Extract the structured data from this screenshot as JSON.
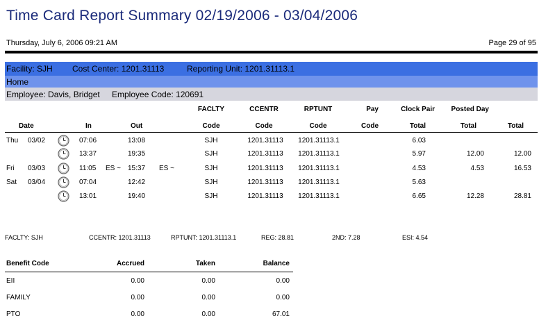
{
  "report": {
    "title": "Time Card Report Summary 02/19/2006 - 03/04/2006",
    "printed": "Thursday, July 6, 2006 09:21 AM",
    "page": "Page 29 of 95"
  },
  "context": {
    "facility": "Facility: SJH",
    "cost_center": "Cost Center: 1201.31113",
    "reporting_unit": "Reporting Unit: 1201.31113.1",
    "home": "Home",
    "employee": "Employee: Davis, Bridget",
    "employee_code": "Employee Code: 120691"
  },
  "columns": {
    "date": "Date",
    "in": "In",
    "out": "Out",
    "facl_top": "FACLTY",
    "facl_bot": "Code",
    "cc_top": "CCENTR",
    "cc_bot": "Code",
    "rpt_top": "RPTUNT",
    "rpt_bot": "Code",
    "pay_top": "Pay",
    "pay_bot": "Code",
    "clock_top": "Clock Pair",
    "clock_bot": "Total",
    "posted_top": "Posted Day",
    "posted_bot": "Total",
    "total": "Total"
  },
  "rows": [
    {
      "day": "Thu",
      "date": "03/02",
      "in": "07:06",
      "in_flag": "",
      "out": "13:08",
      "out_flag": "",
      "faclty": "SJH",
      "ccentr": "1201.31113",
      "rptunt": "1201.31113.1",
      "pay": "",
      "clock_total": "6.03",
      "posted_total": "",
      "total": ""
    },
    {
      "day": "",
      "date": "",
      "in": "13:37",
      "in_flag": "",
      "out": "19:35",
      "out_flag": "",
      "faclty": "SJH",
      "ccentr": "1201.31113",
      "rptunt": "1201.31113.1",
      "pay": "",
      "clock_total": "5.97",
      "posted_total": "12.00",
      "total": "12.00"
    },
    {
      "day": "Fri",
      "date": "03/03",
      "in": "11:05",
      "in_flag": "ES ~",
      "out": "15:37",
      "out_flag": "ES ~",
      "faclty": "SJH",
      "ccentr": "1201.31113",
      "rptunt": "1201.31113.1",
      "pay": "",
      "clock_total": "4.53",
      "posted_total": "4.53",
      "total": "16.53"
    },
    {
      "day": "Sat",
      "date": "03/04",
      "in": "07:04",
      "in_flag": "",
      "out": "12:42",
      "out_flag": "",
      "faclty": "SJH",
      "ccentr": "1201.31113",
      "rptunt": "1201.31113.1",
      "pay": "",
      "clock_total": "5.63",
      "posted_total": "",
      "total": ""
    },
    {
      "day": "",
      "date": "",
      "in": "13:01",
      "in_flag": "",
      "out": "19:40",
      "out_flag": "",
      "faclty": "SJH",
      "ccentr": "1201.31113",
      "rptunt": "1201.31113.1",
      "pay": "",
      "clock_total": "6.65",
      "posted_total": "12.28",
      "total": "28.81"
    }
  ],
  "summary": {
    "faclty": "FACLTY: SJH",
    "ccentr": "CCENTR: 1201.31113",
    "rptunt": "RPTUNT: 1201.31113.1",
    "reg": "REG: 28.81",
    "second": "2ND: 7.28",
    "esi": "ESI: 4.54"
  },
  "benefits": {
    "headers": {
      "code": "Benefit Code",
      "accrued": "Accrued",
      "taken": "Taken",
      "balance": "Balance"
    },
    "rows": [
      {
        "code": "EII",
        "accrued": "0.00",
        "taken": "0.00",
        "balance": "0.00"
      },
      {
        "code": "FAMILY",
        "accrued": "0.00",
        "taken": "0.00",
        "balance": "0.00"
      },
      {
        "code": "PTO",
        "accrued": "0.00",
        "taken": "0.00",
        "balance": "67.01"
      }
    ]
  },
  "icons": {
    "clock": "clock-icon"
  },
  "colors": {
    "title": "#1a2a7a",
    "band_dark": "#3b6fe2",
    "band_mid": "#6f93ec",
    "band_gray": "#d6d6de"
  }
}
